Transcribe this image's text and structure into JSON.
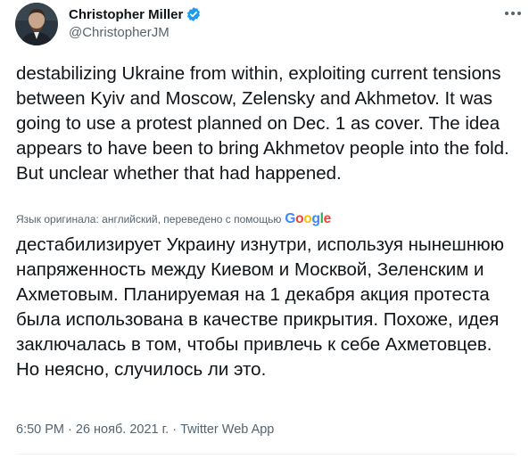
{
  "author": {
    "display_name": "Christopher Miller",
    "handle": "@ChristopherJM",
    "verified": true
  },
  "tweet": {
    "original_text": "destabilizing Ukraine from within, exploiting current tensions between Kyiv and Moscow, Zelensky and Akhmetov. It was going to use a protest planned on Dec. 1 as cover. The idea appears to have been to bring Akhmetov people into the fold. But unclear whether that had happened.",
    "translation_note": "Язык оригинала: английский, переведено с помощью",
    "translated_text": "дестабилизирует Украину изнутри, используя нынешнюю напряженность между Киевом и Москвой, Зеленским и Ахметовым. Планируемая на 1 декабря акция протеста была использована в качестве прикрытия. Похоже, идея заключалась в том, чтобы привлечь к себе Ахметовцев. Но неясно, случилось ли это.",
    "time": "6:50 PM",
    "sep1": " · ",
    "date": "26 нояб. 2021 г.",
    "sep2": " · ",
    "source_app": "Twitter Web App"
  },
  "icons": {
    "verified": "verified-badge-icon",
    "more": "more-horizontal-icon",
    "translation_provider": "google-logo"
  },
  "colors": {
    "text_primary": "#0f1419",
    "text_secondary": "#536471",
    "verified_blue": "#1d9bf0",
    "background": "#ffffff"
  }
}
